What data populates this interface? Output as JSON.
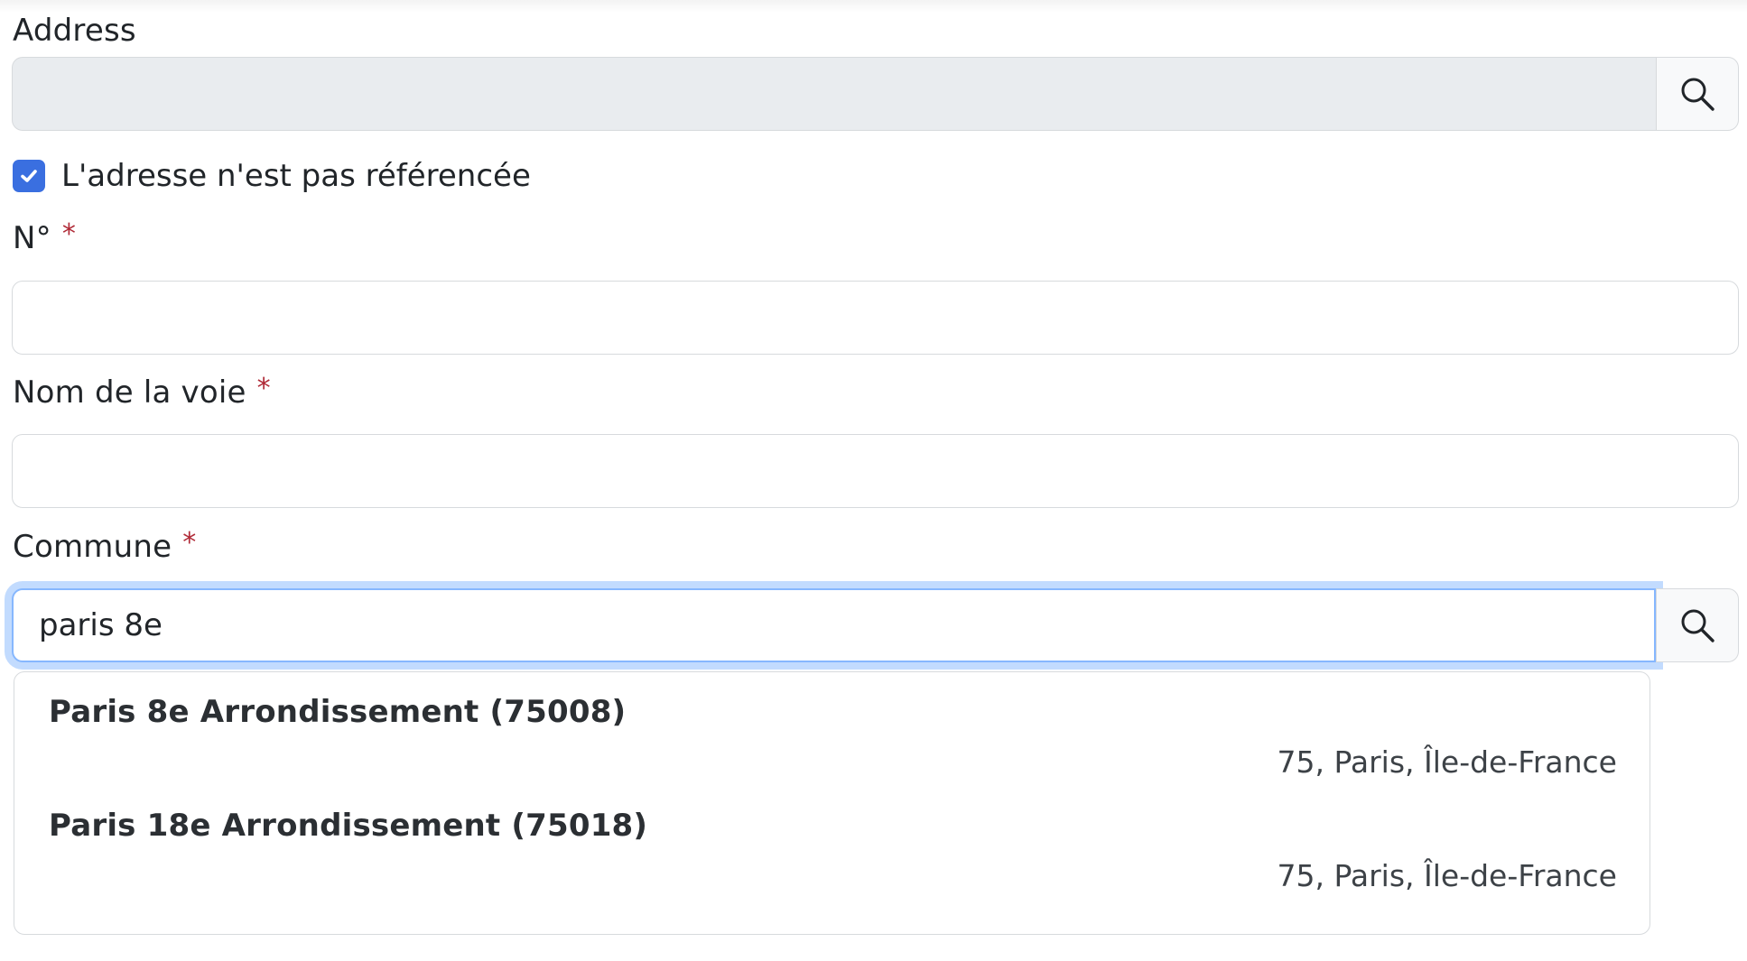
{
  "address": {
    "label": "Address",
    "value": "",
    "search_icon": "search-icon"
  },
  "unreferenced": {
    "label": "L'adresse n'est pas référencée",
    "checked": true
  },
  "numero": {
    "label": "N°",
    "required_marker": "*",
    "value": ""
  },
  "voie": {
    "label": "Nom de la voie",
    "required_marker": "*",
    "value": ""
  },
  "commune": {
    "label": "Commune",
    "required_marker": "*",
    "value": "paris 8e",
    "search_icon": "search-icon"
  },
  "suggestions": [
    {
      "title": "Paris 8e Arrondissement (75008)",
      "subtitle": "75, Paris, Île-de-France"
    },
    {
      "title": "Paris 18e Arrondissement (75018)",
      "subtitle": "75, Paris, Île-de-France"
    }
  ],
  "colors": {
    "checkbox": "#3a6fe0",
    "required": "#b02a37",
    "focus_ring": "#86b7fe",
    "disabled_bg": "#e9ecef"
  }
}
